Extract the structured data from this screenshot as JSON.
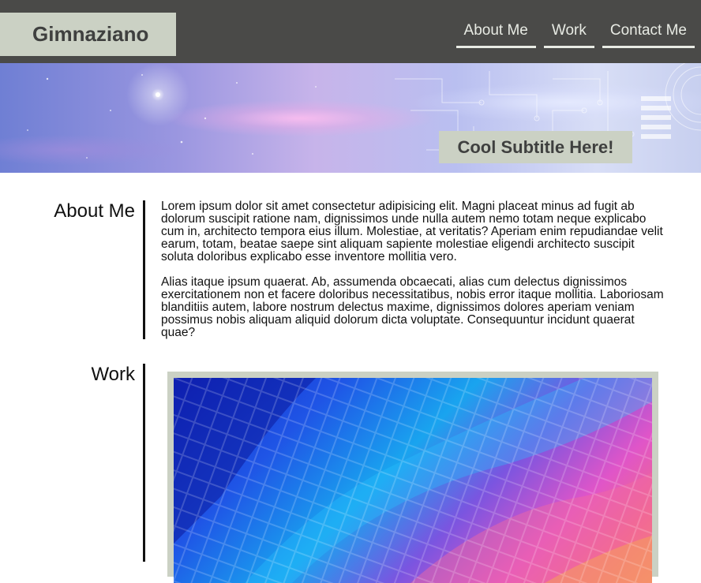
{
  "header": {
    "brand": "Gimnaziano",
    "nav": [
      "About Me",
      "Work",
      "Contact Me"
    ]
  },
  "hero": {
    "subtitle": "Cool Subtitle Here!"
  },
  "sections": {
    "about": {
      "title": "About Me",
      "paragraphs": [
        "Lorem ipsum dolor sit amet consectetur adipisicing elit. Magni placeat minus ad fugit ab dolorum suscipit ratione nam, dignissimos unde nulla autem nemo totam neque explicabo cum in, architecto tempora eius illum. Molestiae, at veritatis? Aperiam enim repudiandae velit earum, totam, beatae saepe sint aliquam sapiente molestiae eligendi architecto suscipit soluta doloribus explicabo esse inventore mollitia vero.",
        "Alias itaque ipsum quaerat. Ab, assumenda obcaecati, alias cum delectus dignissimos exercitationem non et facere doloribus necessitatibus, nobis error itaque mollitia. Laboriosam blanditiis autem, labore nostrum delectus maxime, dignissimos dolores aperiam veniam possimus nobis aliquam aliquid dolorum dicta voluptate. Consequuntur incidunt quaerat quae?"
      ]
    },
    "work": {
      "title": "Work"
    }
  },
  "colors": {
    "header_bg": "#4a4a48",
    "accent_box": "#cbd1c4",
    "nav_text": "#e8ebe4"
  }
}
